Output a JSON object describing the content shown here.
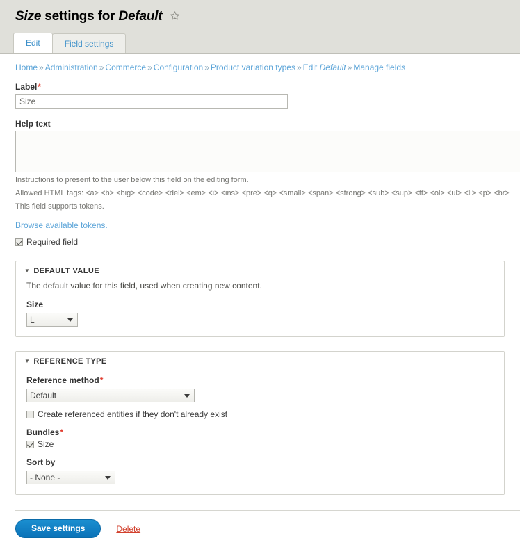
{
  "header": {
    "title_field": "Size",
    "title_mid": " settings for ",
    "title_bundle": "Default",
    "star_icon": "star-outline-icon"
  },
  "tabs": [
    {
      "label": "Edit",
      "active": true
    },
    {
      "label": "Field settings",
      "active": false
    }
  ],
  "breadcrumb": {
    "separator": "»",
    "items": [
      {
        "label": "Home",
        "italic": false
      },
      {
        "label": "Administration",
        "italic": false
      },
      {
        "label": "Commerce",
        "italic": false
      },
      {
        "label": "Configuration",
        "italic": false
      },
      {
        "label": "Product variation types",
        "italic": false
      },
      {
        "label": "Edit ",
        "italic": false,
        "suffix": "Default"
      },
      {
        "label": "Manage fields",
        "italic": false
      }
    ],
    "edit_prefix": "Edit ",
    "edit_italic": "Default"
  },
  "form": {
    "label_field": {
      "label": "Label",
      "required_mark": "*",
      "value": "Size"
    },
    "help_text": {
      "label": "Help text",
      "value": "",
      "descriptions": [
        "Instructions to present to the user below this field on the editing form.",
        "Allowed HTML tags: <a> <b> <big> <code> <del> <em> <i> <ins> <pre> <q> <small> <span> <strong> <sub> <sup> <tt> <ol> <ul> <li> <p> <br>",
        "This field supports tokens."
      ]
    },
    "tokens_link": "Browse available tokens.",
    "required_field": {
      "label": "Required field",
      "checked": true
    }
  },
  "default_value": {
    "title": "DEFAULT VALUE",
    "triangle": "▼",
    "description": "The default value for this field, used when creating new content.",
    "size_label": "Size",
    "size_value": "L",
    "size_options": [
      "L"
    ]
  },
  "reference_type": {
    "title": "REFERENCE TYPE",
    "triangle": "▼",
    "reference_method": {
      "label": "Reference method",
      "required_mark": "*",
      "value": "Default",
      "options": [
        "Default"
      ]
    },
    "auto_create": {
      "label": "Create referenced entities if they don't already exist",
      "checked": false
    },
    "bundles": {
      "label": "Bundles",
      "required_mark": "*",
      "items": [
        {
          "label": "Size",
          "checked": true
        }
      ]
    },
    "sort_by": {
      "label": "Sort by",
      "value": "- None -",
      "options": [
        "- None -"
      ]
    }
  },
  "actions": {
    "save_label": "Save settings",
    "delete_label": "Delete"
  },
  "colors": {
    "header_bg": "#e0e0da",
    "link": "#5ba4d8",
    "required": "#e13b2e",
    "primary_button": "#0a72b8",
    "delete": "#d2402c"
  }
}
